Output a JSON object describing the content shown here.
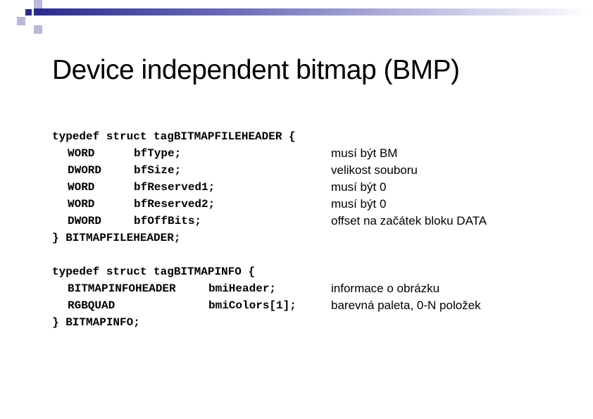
{
  "title": "Device independent bitmap (BMP)",
  "block1": {
    "open": "typedef struct tagBITMAPFILEHEADER {",
    "fields": [
      {
        "type": "WORD",
        "name": "bfType;",
        "comment": "musí být BM"
      },
      {
        "type": "DWORD",
        "name": "bfSize;",
        "comment": "velikost souboru"
      },
      {
        "type": "WORD",
        "name": "bfReserved1;",
        "comment": "musí být 0"
      },
      {
        "type": "WORD",
        "name": "bfReserved2;",
        "comment": "musí být 0"
      },
      {
        "type": "DWORD",
        "name": "bfOffBits;",
        "comment": "offset na začátek bloku DATA"
      }
    ],
    "close": "} BITMAPFILEHEADER;"
  },
  "block2": {
    "open": "typedef struct tagBITMAPINFO {",
    "fields": [
      {
        "type": "BITMAPINFOHEADER",
        "name": "bmiHeader;",
        "comment": "informace o obrázku"
      },
      {
        "type": "RGBQUAD",
        "name": "bmiColors[1];",
        "comment": "barevná paleta, 0-N položek"
      }
    ],
    "close": "} BITMAPINFO;"
  }
}
